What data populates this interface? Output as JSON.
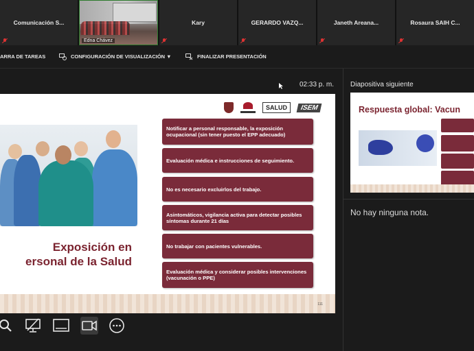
{
  "participants": [
    {
      "name": "Comunicación S...",
      "type": "name"
    },
    {
      "name": "Edna Chávez",
      "type": "video"
    },
    {
      "name": "Kary",
      "type": "name"
    },
    {
      "name": "GERARDO VAZQ...",
      "type": "name"
    },
    {
      "name": "Janeth Areana...",
      "type": "name"
    },
    {
      "name": "Rosaura SAIH C...",
      "type": "name"
    }
  ],
  "toolbar": {
    "taskbar_label": "ARRA DE TAREAS",
    "display_settings_label": "CONFIGURACIÓN DE VISUALIZACIÓN ▼",
    "end_presentation_label": "FINALIZAR PRESENTACIÓN"
  },
  "presenter": {
    "time": "02:33 p. m.",
    "next_slide_label": "Diapositiva siguiente",
    "notes_text": "No hay ninguna nota."
  },
  "slide": {
    "title_line1": "Exposición en",
    "title_line2": "ersonal de la Salud",
    "logo_salud": "SALUD",
    "logo_isem": "ISEM",
    "page_number": "111",
    "boxes": [
      "Notificar a personal responsable, la exposición ocupacional (sin tener puesto el EPP adecuado)",
      "Evaluación médica e instrucciones de seguimiento.",
      "No es necesario excluirlos  del trabajo.",
      "Asintomáticos, vigilancia activa para detectar posibles síntomas durante 21 días",
      "No trabajar con pacientes vulnerables.",
      "Evaluación médica y considerar posibles intervenciones (vacunación o PPE)"
    ]
  },
  "next_slide": {
    "title": "Respuesta global: Vacun"
  },
  "colors": {
    "accent": "#7a2b3a",
    "title_text": "#7b2430",
    "background": "#1b1b1b"
  },
  "icons": {
    "controls": [
      "search-icon",
      "screen-share-icon",
      "presenter-view-icon",
      "camera-icon",
      "more-options-icon"
    ]
  }
}
